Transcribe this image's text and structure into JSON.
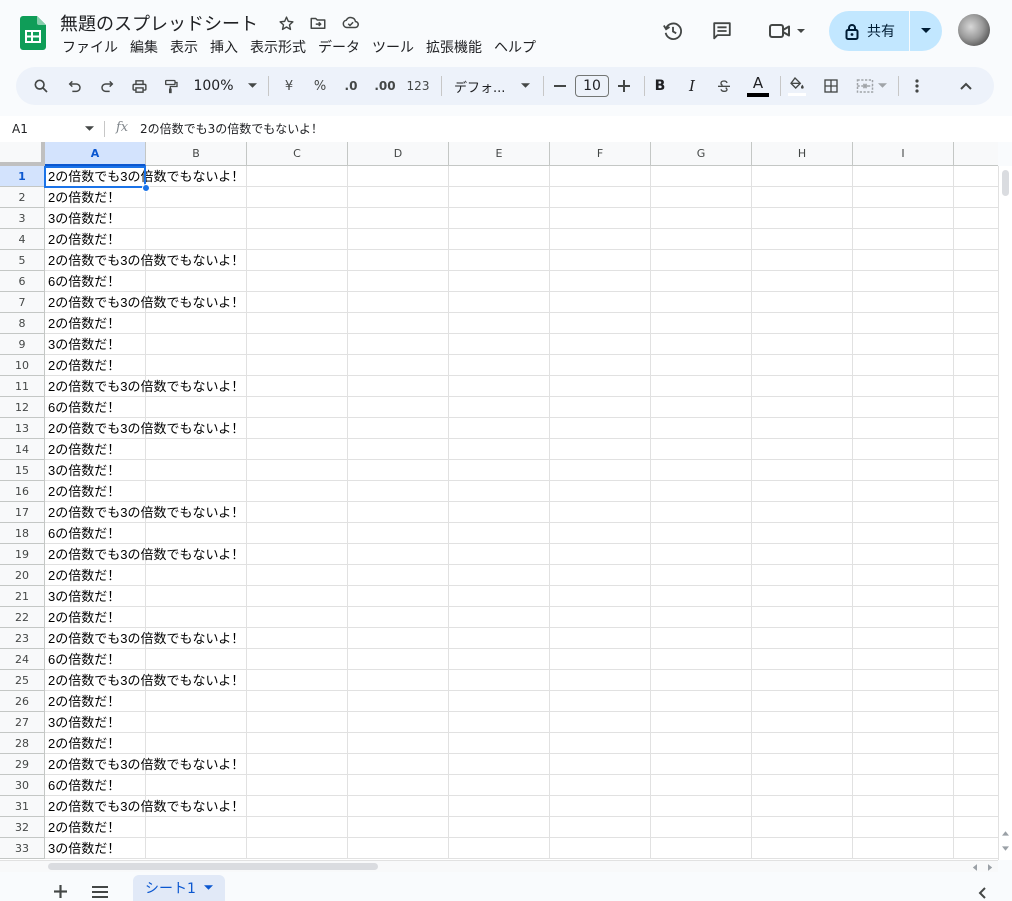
{
  "doc": {
    "title": "無題のスプレッドシート"
  },
  "menu": [
    "ファイル",
    "編集",
    "表示",
    "挿入",
    "表示形式",
    "データ",
    "ツール",
    "拡張機能",
    "ヘルプ"
  ],
  "share": {
    "label": "共有"
  },
  "toolbar": {
    "zoom": "100%",
    "currency": "¥",
    "percent": "%",
    "dec_decrease": ".0",
    "dec_increase": ".00",
    "number_format": "123",
    "font": "デフォ...",
    "font_size": "10",
    "bold": "B",
    "italic": "I",
    "text_color": "A"
  },
  "formula_bar": {
    "cell_ref": "A1",
    "fx": "fx",
    "content": "2の倍数でも3の倍数でもないよ！"
  },
  "grid": {
    "columns": [
      "A",
      "B",
      "C",
      "D",
      "E",
      "F",
      "G",
      "H",
      "I"
    ],
    "selected_column": "A",
    "selected_row": "1",
    "rows": [
      {
        "n": "1",
        "a": "2の倍数でも3の倍数でもないよ！"
      },
      {
        "n": "2",
        "a": "2の倍数だ！"
      },
      {
        "n": "3",
        "a": "3の倍数だ！"
      },
      {
        "n": "4",
        "a": "2の倍数だ！"
      },
      {
        "n": "5",
        "a": "2の倍数でも3の倍数でもないよ！"
      },
      {
        "n": "6",
        "a": "6の倍数だ！"
      },
      {
        "n": "7",
        "a": "2の倍数でも3の倍数でもないよ！"
      },
      {
        "n": "8",
        "a": "2の倍数だ！"
      },
      {
        "n": "9",
        "a": "3の倍数だ！"
      },
      {
        "n": "10",
        "a": "2の倍数だ！"
      },
      {
        "n": "11",
        "a": "2の倍数でも3の倍数でもないよ！"
      },
      {
        "n": "12",
        "a": "6の倍数だ！"
      },
      {
        "n": "13",
        "a": "2の倍数でも3の倍数でもないよ！"
      },
      {
        "n": "14",
        "a": "2の倍数だ！"
      },
      {
        "n": "15",
        "a": "3の倍数だ！"
      },
      {
        "n": "16",
        "a": "2の倍数だ！"
      },
      {
        "n": "17",
        "a": "2の倍数でも3の倍数でもないよ！"
      },
      {
        "n": "18",
        "a": "6の倍数だ！"
      },
      {
        "n": "19",
        "a": "2の倍数でも3の倍数でもないよ！"
      },
      {
        "n": "20",
        "a": "2の倍数だ！"
      },
      {
        "n": "21",
        "a": "3の倍数だ！"
      },
      {
        "n": "22",
        "a": "2の倍数だ！"
      },
      {
        "n": "23",
        "a": "2の倍数でも3の倍数でもないよ！"
      },
      {
        "n": "24",
        "a": "6の倍数だ！"
      },
      {
        "n": "25",
        "a": "2の倍数でも3の倍数でもないよ！"
      },
      {
        "n": "26",
        "a": "2の倍数だ！"
      },
      {
        "n": "27",
        "a": "3の倍数だ！"
      },
      {
        "n": "28",
        "a": "2の倍数だ！"
      },
      {
        "n": "29",
        "a": "2の倍数でも3の倍数でもないよ！"
      },
      {
        "n": "30",
        "a": "6の倍数だ！"
      },
      {
        "n": "31",
        "a": "2の倍数でも3の倍数でもないよ！"
      },
      {
        "n": "32",
        "a": "2の倍数だ！"
      },
      {
        "n": "33",
        "a": "3の倍数だ！"
      }
    ]
  },
  "sheets": [
    {
      "label": "シート1",
      "active": true
    }
  ],
  "colors": {
    "accent": "#1a73e8",
    "share_bg": "#c2e7ff",
    "sheets_green": "#0f9d58"
  }
}
